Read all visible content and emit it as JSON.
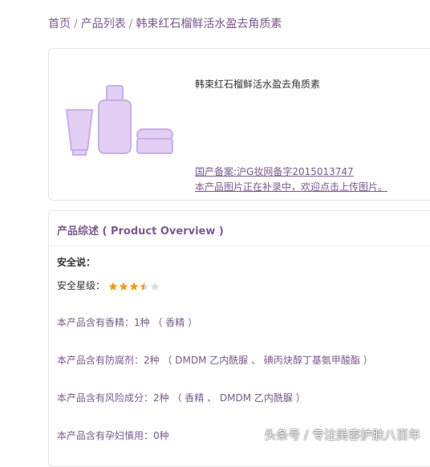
{
  "breadcrumb": {
    "home": "首页",
    "separator": "/",
    "list": "产品列表",
    "current": "韩束红石榴鲜活水盈去角质素"
  },
  "product": {
    "title": "韩束红石榴鲜活水盈去角质素",
    "record_text": "国产备案:沪G妆网备字2015013747",
    "upload_text": "本产品图片正在补录中，欢迎点击上传图片。",
    "image_icon": "cosmetics-placeholder-icon"
  },
  "overview": {
    "title": "产品综述 ( Product Overview )",
    "safety_label": "安全说：",
    "rating_label": "安全星级：",
    "rating": {
      "value": 3.5,
      "max": 5
    },
    "lines": [
      "本产品含有香精：1种 （ 香精 ）",
      "本产品含有防腐剂：2种 （ DMDM 乙内酰脲 、 碘丙炔醇丁基氨甲酸酯 ）",
      "本产品含有风险成分：2种 （ 香精 、 DMDM 乙内酰脲 ）",
      "本产品含有孕妇慎用：0种"
    ]
  },
  "watermark": "头条号 / 专注美容护肤八百年",
  "colors": {
    "accent": "#7b5a8e",
    "star_on": "#f39c12",
    "star_off": "#dddddd",
    "image_fill": "#e2cff3",
    "image_stroke": "#c9aeea"
  }
}
